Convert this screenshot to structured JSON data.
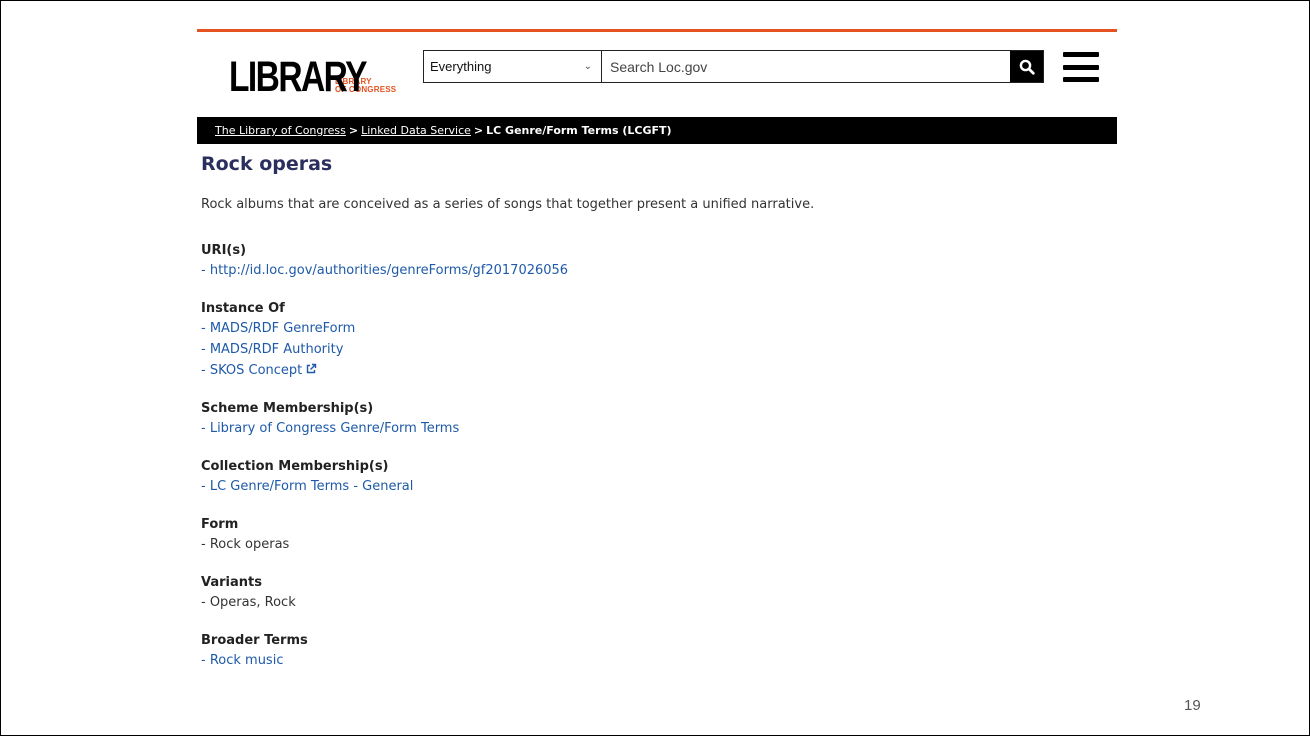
{
  "logo": {
    "main": "LIBRARY",
    "sub_line1": "LIBRARY",
    "sub_line2": "OF CONGRESS"
  },
  "search": {
    "scope": "Everything",
    "placeholder": "Search Loc.gov"
  },
  "breadcrumb": {
    "items": [
      "The Library of Congress",
      "Linked Data Service"
    ],
    "separator": ">",
    "current": "LC Genre/Form Terms (LCGFT)"
  },
  "page": {
    "title": "Rock operas",
    "definition": "Rock albums that are conceived as a series of songs that together present a unified narrative."
  },
  "sections": [
    {
      "label": "URI(s)",
      "items": [
        {
          "text": "- http://id.loc.gov/authorities/genreForms/gf2017026056",
          "link": true
        }
      ]
    },
    {
      "label": "Instance Of",
      "items": [
        {
          "text": "- MADS/RDF GenreForm",
          "link": true
        },
        {
          "text": "- MADS/RDF Authority",
          "link": true
        },
        {
          "text": "- SKOS Concept",
          "link": true,
          "external": true
        }
      ]
    },
    {
      "label": "Scheme Membership(s)",
      "items": [
        {
          "text": "- Library of Congress Genre/Form Terms",
          "link": true
        }
      ]
    },
    {
      "label": "Collection Membership(s)",
      "items": [
        {
          "text": "- LC Genre/Form Terms - General",
          "link": true
        }
      ]
    },
    {
      "label": "Form",
      "items": [
        {
          "text": "- Rock operas",
          "link": false
        }
      ]
    },
    {
      "label": "Variants",
      "items": [
        {
          "text": "- Operas, Rock",
          "link": false
        }
      ]
    },
    {
      "label": "Broader Terms",
      "items": [
        {
          "text": "- Rock music",
          "link": true
        }
      ]
    }
  ],
  "slide": {
    "page_number": "19"
  },
  "colors": {
    "accent": "#e3521f",
    "title": "#2b2f5e",
    "link": "#1e5aa8"
  },
  "icons": {
    "search": "search-icon",
    "menu": "menu-icon",
    "external": "external-link-icon"
  }
}
